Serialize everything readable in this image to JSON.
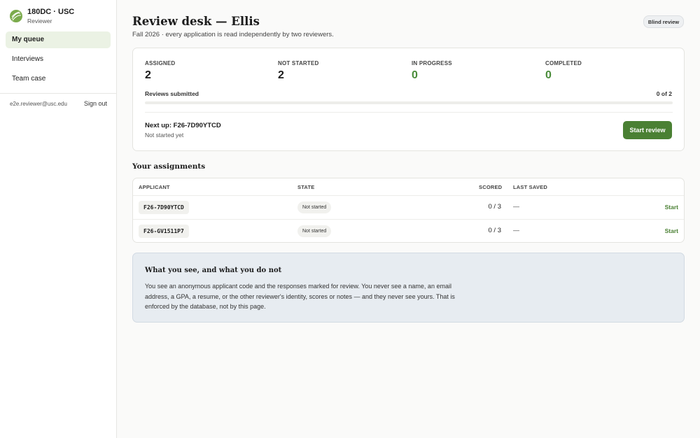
{
  "brand": {
    "name": "180DC · USC",
    "role": "Reviewer"
  },
  "nav": {
    "items": [
      {
        "label": "My queue",
        "active": true
      },
      {
        "label": "Interviews"
      },
      {
        "label": "Team case"
      }
    ]
  },
  "user": {
    "email": "e2e.reviewer@usc.edu",
    "signout_label": "Sign out"
  },
  "header": {
    "title": "Review desk — Ellis",
    "subtitle": "Fall 2026 · every application is read independently by two reviewers.",
    "badge": "Blind review"
  },
  "stats": [
    {
      "label": "ASSIGNED",
      "value": "2"
    },
    {
      "label": "NOT STARTED",
      "value": "2"
    },
    {
      "label": "IN PROGRESS",
      "value": "0"
    },
    {
      "label": "COMPLETED",
      "value": "0"
    }
  ],
  "progress": {
    "label": "Reviews submitted",
    "count_text": "0 of 2",
    "fraction": 0
  },
  "next": {
    "title": "Next up: F26-7D90YTCD",
    "subtitle": "Not started yet",
    "button_label": "Start review"
  },
  "assignments": {
    "title": "Your assignments",
    "columns": {
      "applicant": "APPLICANT",
      "state": "STATE",
      "scored": "SCORED",
      "last_saved": "LAST SAVED"
    },
    "rows": [
      {
        "code": "F26-7D90YTCD",
        "state": "Not started",
        "scored": "0 / 3",
        "last_saved": "—",
        "action": "Start"
      },
      {
        "code": "F26-GV1511P7",
        "state": "Not started",
        "scored": "0 / 3",
        "last_saved": "—",
        "action": "Start"
      }
    ]
  },
  "info": {
    "title": "What you see, and what you do not",
    "body": "You see an anonymous applicant code and the responses marked for review. You never see a name, an email address, a GPA, a resume, or the other reviewer's identity, scores or notes — and they never see yours. That is enforced by the database, not by this page."
  },
  "colors": {
    "accent": "#4a8033",
    "accent_light": "#ebf2e4",
    "info_bg": "#e7ecf1"
  }
}
